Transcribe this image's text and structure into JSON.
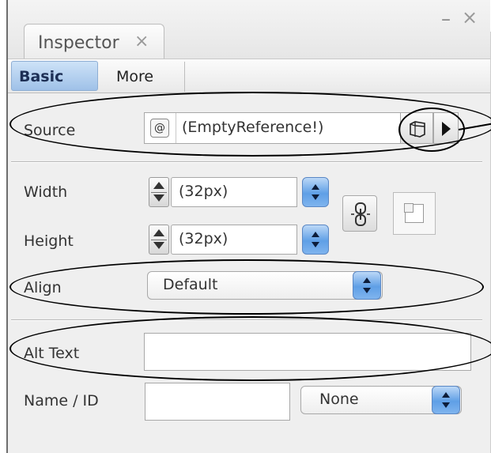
{
  "window": {
    "minimize_glyph": "–",
    "close_glyph": "×"
  },
  "tabs": {
    "inspector_label": "Inspector",
    "inspector_close_glyph": "×"
  },
  "subtabs": [
    {
      "label": "Basic",
      "selected": true
    },
    {
      "label": "More",
      "selected": false
    }
  ],
  "source": {
    "label": "Source",
    "value": "(EmptyReference!)",
    "ref_icon": "@-ref-icon",
    "browse_icon": "folder-browse-icon",
    "menu_icon": "triangle-right-icon"
  },
  "width": {
    "label": "Width",
    "value": "(32px)"
  },
  "height": {
    "label": "Height",
    "value": "(32px)"
  },
  "constrain_icon": "chain-link-icon",
  "crop_icon": "crop-icon",
  "align": {
    "label": "Align",
    "value": "Default"
  },
  "alt_text": {
    "label": "Alt Text",
    "value": ""
  },
  "name_id": {
    "label": "Name / ID",
    "value": "",
    "type_select": "None"
  },
  "colors": {
    "selected_tab": "#a8c8ec",
    "aqua_button": "#6aa6ea",
    "annotation": "#000000"
  }
}
